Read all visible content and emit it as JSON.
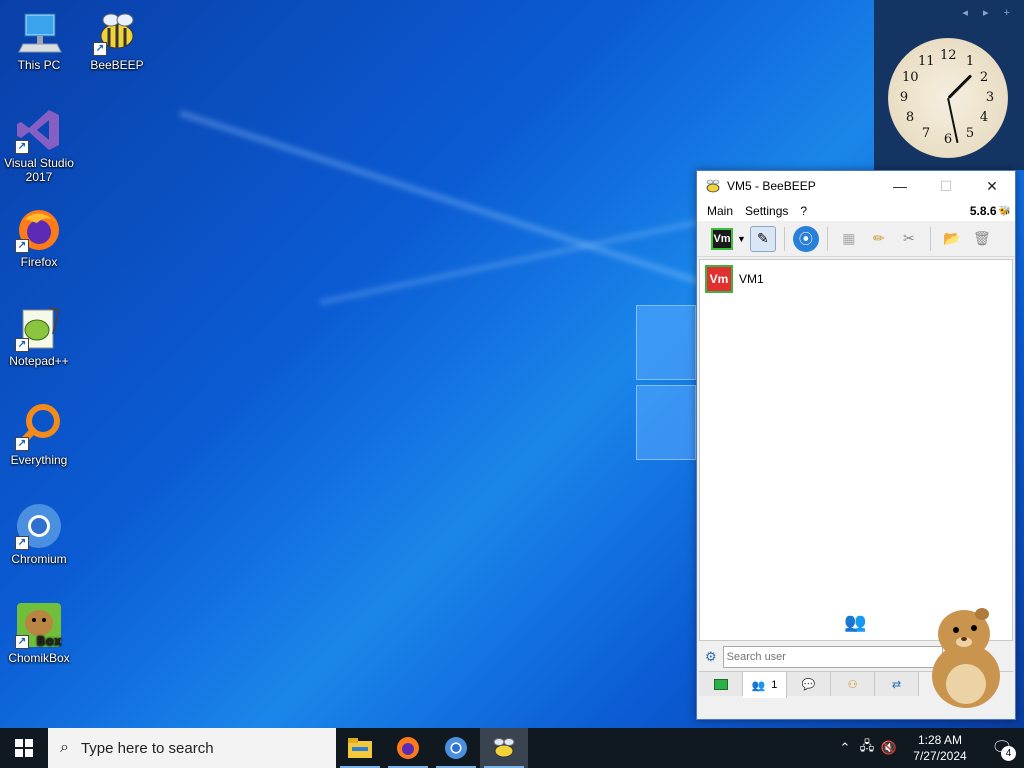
{
  "desktop": {
    "icons": [
      {
        "label": "This PC",
        "icon": "computer-icon"
      },
      {
        "label": "BeeBEEP",
        "icon": "bee-icon"
      },
      {
        "label": "Visual Studio\n2017",
        "icon": "visual-studio-icon"
      },
      {
        "label": "Firefox",
        "icon": "firefox-icon"
      },
      {
        "label": "Notepad++",
        "icon": "notepadpp-icon"
      },
      {
        "label": "Everything",
        "icon": "everything-icon"
      },
      {
        "label": "Chromium",
        "icon": "chromium-icon"
      },
      {
        "label": "ChomikBox",
        "icon": "chomikbox-icon"
      }
    ]
  },
  "gadget": {
    "clock_numbers": [
      "12",
      "1",
      "2",
      "3",
      "4",
      "5",
      "6",
      "7",
      "8",
      "9",
      "10",
      "11"
    ],
    "time_shown": "1:28"
  },
  "beebeep": {
    "title": "VM5 - BeeBEEP",
    "menu": [
      "Main",
      "Settings",
      "?"
    ],
    "version": "5.8.6",
    "status_badge": "Vm",
    "users": [
      {
        "badge": "Vm",
        "name": "VM1"
      }
    ],
    "search_placeholder": "Search user",
    "tab_users_count": "1"
  },
  "taskbar": {
    "search_placeholder": "Type here to search",
    "time": "1:28 AM",
    "date": "7/27/2024",
    "notification_count": "4"
  },
  "colors": {
    "taskbar_bg": "#101820",
    "accent": "#0b5bd3",
    "window_border": "#4a78c0"
  }
}
